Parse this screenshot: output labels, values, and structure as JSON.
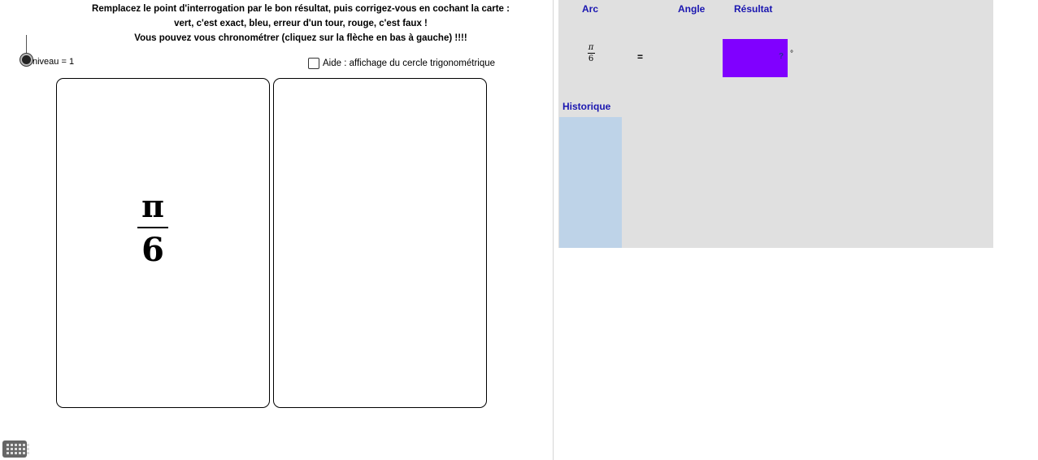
{
  "instructions": {
    "line1": "Remplacez le point d'interrogation par le bon résultat, puis corrigez-vous en cochant la carte :",
    "line2": "vert, c'est exact, bleu, erreur d'un tour, rouge, c'est faux !",
    "line3": "Vous pouvez vous chronométrer (cliquez sur la flèche en bas à gauche) !!!!"
  },
  "slider": {
    "label": "niveau = 1",
    "value": 1
  },
  "help_checkbox": {
    "label": "Aide : affichage du cercle trigonométrique",
    "checked": false
  },
  "card_left": {
    "numerator": "π",
    "denominator": "6"
  },
  "table": {
    "col_arc": "Arc",
    "col_angle": "Angle",
    "col_result": "Résultat",
    "arc_numerator": "π",
    "arc_denominator": "6",
    "equals": "=",
    "result_placeholder": "?",
    "degree_symbol": "°",
    "result_color": "#8000ff"
  },
  "history": {
    "label": "Historique"
  },
  "icons": {
    "keyboard": "keyboard-icon"
  }
}
